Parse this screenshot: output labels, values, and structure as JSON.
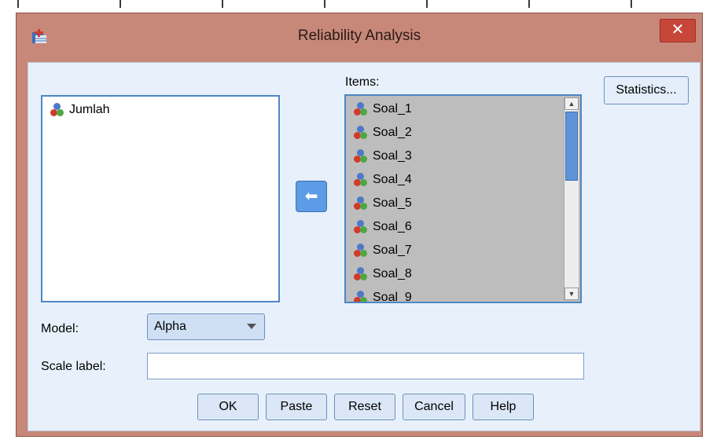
{
  "window": {
    "title": "Reliability Analysis",
    "close_glyph": "✕"
  },
  "source_list": {
    "items": [
      "Jumlah"
    ]
  },
  "items_section": {
    "label": "Items:",
    "items": [
      "Soal_1",
      "Soal_2",
      "Soal_3",
      "Soal_4",
      "Soal_5",
      "Soal_6",
      "Soal_7",
      "Soal_8",
      "Soal_9"
    ]
  },
  "statistics_button": "Statistics...",
  "model": {
    "label": "Model:",
    "value": "Alpha"
  },
  "scale_label": {
    "label": "Scale label:",
    "value": ""
  },
  "buttons": {
    "ok": "OK",
    "paste": "Paste",
    "reset": "Reset",
    "cancel": "Cancel",
    "help": "Help"
  },
  "icons": {
    "move": "arrow-left-icon",
    "variable": "scale-variable-icon",
    "app": "spss-app-icon"
  },
  "colors": {
    "title_bar": "#c7887a",
    "close": "#c7463a",
    "client_bg": "#e8f1fb",
    "accent": "#4d86c4"
  }
}
